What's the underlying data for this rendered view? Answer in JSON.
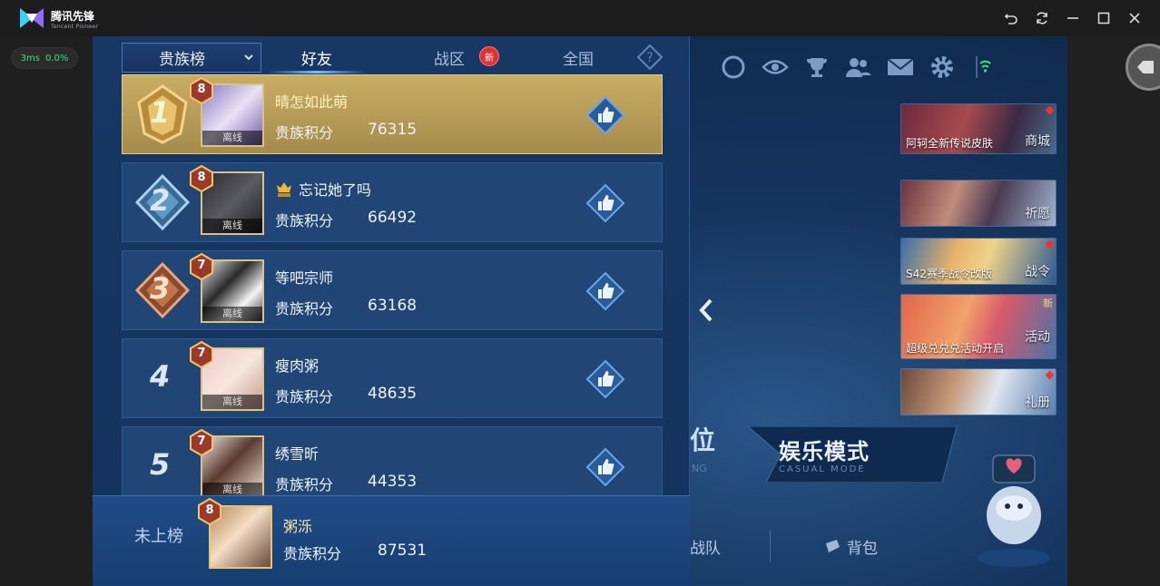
{
  "window": {
    "brand_name": "腾讯先锋",
    "brand_sub": "Tencent Pioneer"
  },
  "perf": {
    "latency": "3ms",
    "loss": "0.0%"
  },
  "leaderboard": {
    "dropdown_label": "贵族榜",
    "tabs": [
      {
        "label": "好友",
        "active": true
      },
      {
        "label": "战区",
        "badge": "新"
      },
      {
        "label": "全国"
      }
    ],
    "score_label": "贵族积分",
    "offline_label": "离线",
    "rows": [
      {
        "rank": "1",
        "level": "8",
        "name": "晴怎如此萌",
        "score": "76315",
        "svip": false
      },
      {
        "rank": "2",
        "level": "8",
        "name": "忘记她了吗",
        "score": "66492",
        "svip": true
      },
      {
        "rank": "3",
        "level": "7",
        "name": "等吧宗师",
        "score": "63168",
        "svip": false
      },
      {
        "rank": "4",
        "level": "7",
        "name": "瘦肉粥",
        "score": "48635",
        "svip": false
      },
      {
        "rank": "5",
        "level": "7",
        "name": "绣雪昕",
        "score": "44353",
        "svip": false
      }
    ],
    "me": {
      "status": "未上榜",
      "level": "8",
      "name": "粥泺",
      "score": "87531"
    }
  },
  "promos": [
    {
      "text": "阿轲全新传说皮肤",
      "label": "商城"
    },
    {
      "text": "",
      "label": "祈愿"
    },
    {
      "text": "S42赛季战令改版",
      "label": "战令"
    },
    {
      "text": "超级兑兑兑活动开启",
      "label": "活动",
      "new": "新"
    },
    {
      "text": "",
      "label": "礼册"
    }
  ],
  "modes": {
    "rank_char": "位",
    "rank_sub": "NG",
    "casual_title": "娱乐模式",
    "casual_sub": "CASUAL MODE"
  },
  "bottom_nav": [
    {
      "label": "战队"
    },
    {
      "label": "背包"
    }
  ],
  "colors": {
    "gold_row": "#c9ad63",
    "row_bg": "#214675",
    "accent": "#73c3ff"
  }
}
